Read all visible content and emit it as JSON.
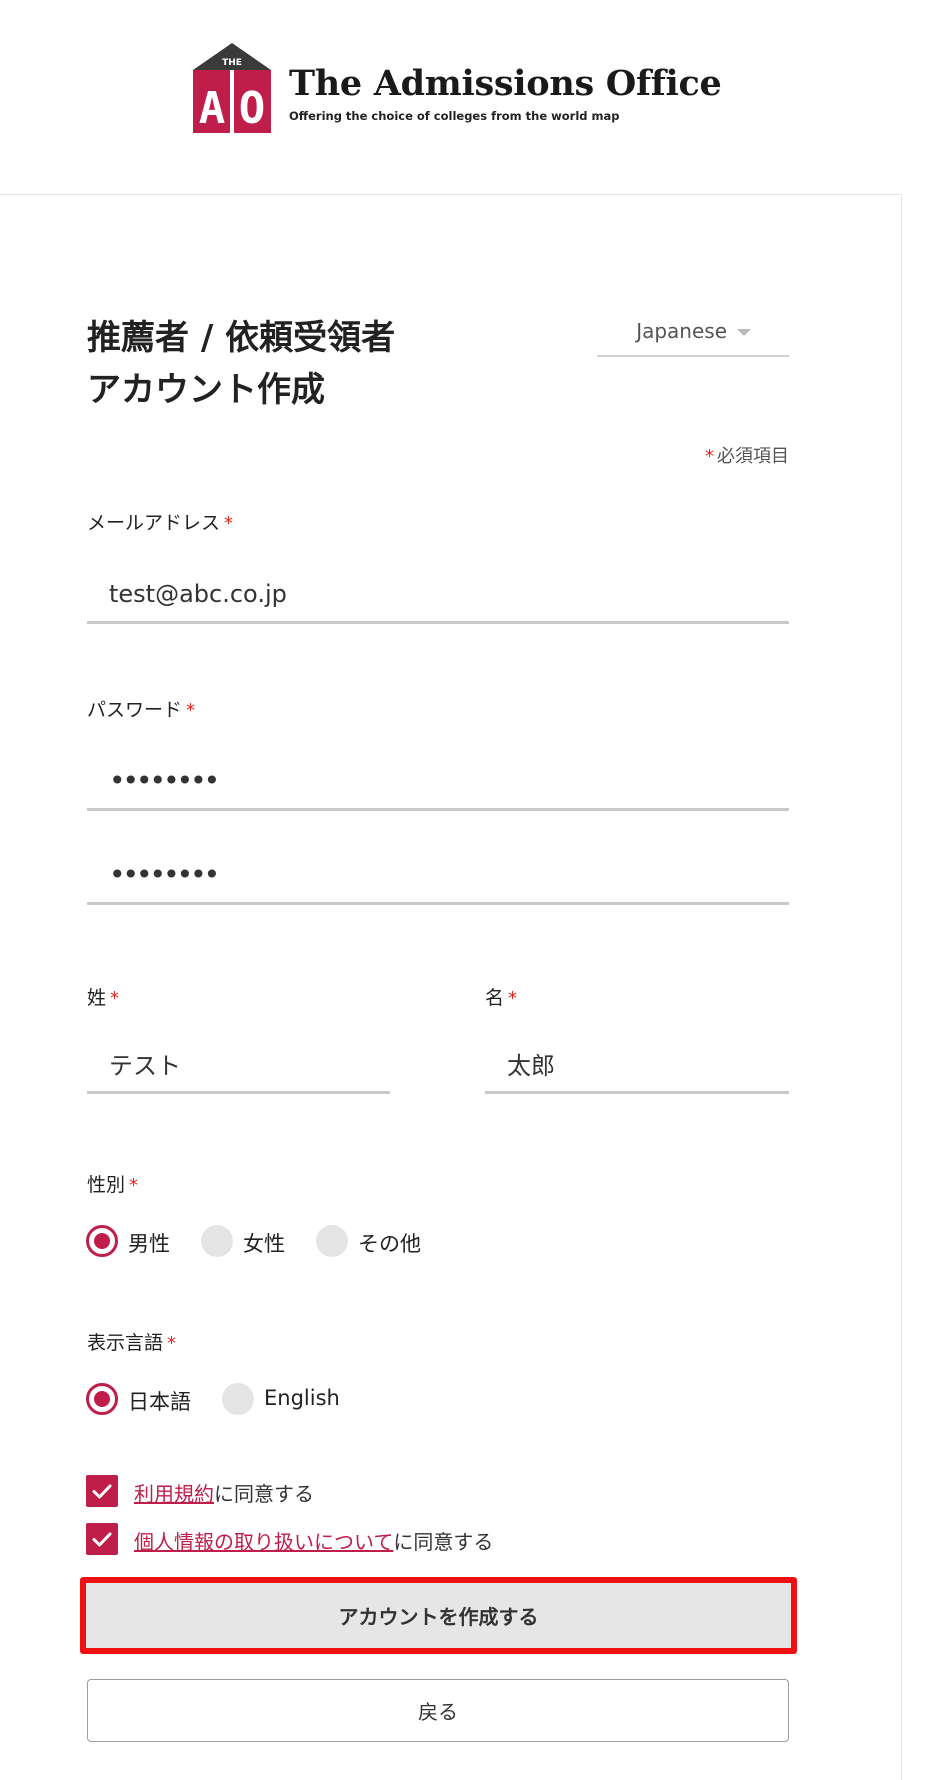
{
  "header": {
    "logo_badge": "THE",
    "logo_letters": [
      "A",
      "O"
    ],
    "title": "The Admissions Office",
    "tagline": "Offering the choice of colleges from the world map"
  },
  "form": {
    "title_line1": "推薦者 / 依頼受領者",
    "title_line2": "アカウント作成",
    "language_select": {
      "value": "Japanese"
    },
    "required_mark": "*",
    "required_note": "必須項目",
    "email": {
      "label": "メールアドレス",
      "value": "test@abc.co.jp"
    },
    "password": {
      "label": "パスワード",
      "value": "••••••••",
      "confirm_value": "••••••••"
    },
    "last_name": {
      "label": "姓",
      "value": "テスト"
    },
    "first_name": {
      "label": "名",
      "value": "太郎"
    },
    "gender": {
      "label": "性別",
      "options": [
        "男性",
        "女性",
        "その他"
      ],
      "selected": "男性"
    },
    "display_language": {
      "label": "表示言語",
      "options": [
        "日本語",
        "English"
      ],
      "selected": "日本語"
    },
    "agreements": [
      {
        "link": "利用規約",
        "suffix": "に同意する",
        "checked": true
      },
      {
        "link": "個人情報の取り扱いについて",
        "suffix": "に同意する",
        "checked": true
      }
    ],
    "submit_label": "アカウントを作成する",
    "back_label": "戻る"
  },
  "colors": {
    "accent": "#bf1e4b",
    "required_star": "#e0251b",
    "highlight_border": "#ee1111",
    "logo_roof": "#3a3a3a"
  }
}
